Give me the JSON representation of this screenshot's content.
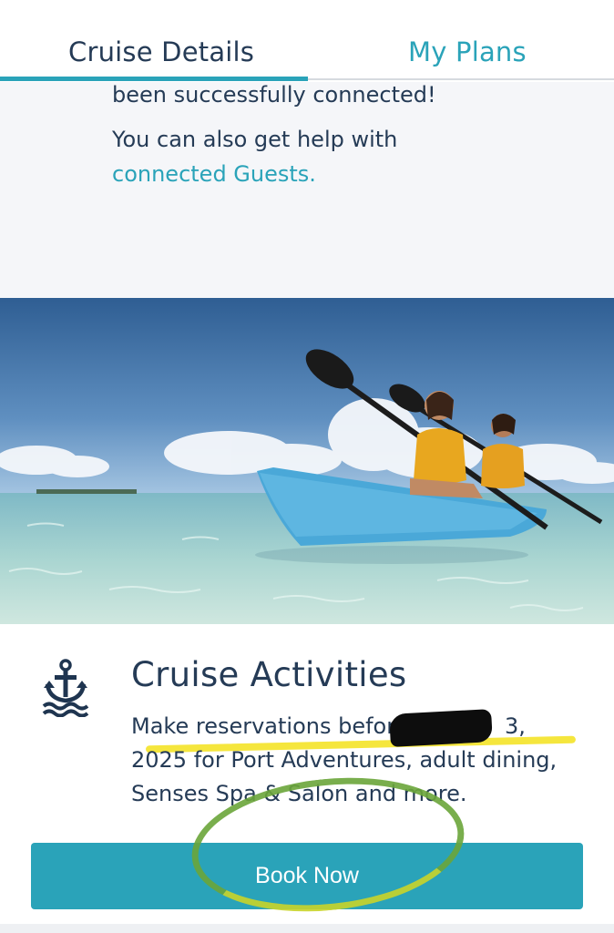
{
  "tabs": [
    {
      "label": "Cruise Details",
      "active": true
    },
    {
      "label": "My Plans",
      "active": false
    }
  ],
  "connected": {
    "line1": "been successfully connected!",
    "line2": "You can also get help with",
    "link": "connected Guests."
  },
  "hero": {
    "subject": "two people kayaking in clear tropical water"
  },
  "activities": {
    "icon": "anchor-icon",
    "title": "Cruise Activities",
    "desc_part1": "Make reservations before ",
    "desc_part2": "3, 2025",
    "desc_part3": "for Port Adventures, adult dining, Senses Spa & Salon and more.",
    "button_label": "Book Now"
  },
  "colors": {
    "accent": "#2aa3b9",
    "text_dark": "#253b56",
    "highlight_yellow": "#f3e21b",
    "circle_green": "#6ba63a"
  }
}
